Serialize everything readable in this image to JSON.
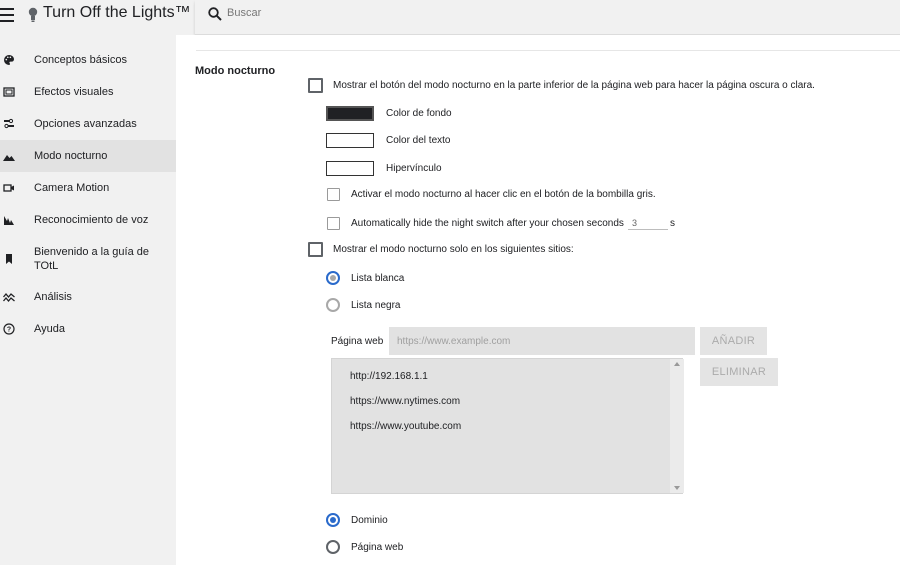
{
  "header": {
    "app_title": "Turn Off the Lights™",
    "search_placeholder": "Buscar"
  },
  "sidebar": {
    "items": [
      {
        "label": "Conceptos básicos",
        "icon": "palette-icon"
      },
      {
        "label": "Efectos visuales",
        "icon": "monitor-icon"
      },
      {
        "label": "Opciones avanzadas",
        "icon": "settings-sliders-icon"
      },
      {
        "label": "Modo nocturno",
        "icon": "landscape-icon",
        "active": true
      },
      {
        "label": "Camera Motion",
        "icon": "camera-icon"
      },
      {
        "label": "Reconocimiento de voz",
        "icon": "voice-wave-icon"
      },
      {
        "label": "Bienvenido a la guía de TOtL",
        "icon": "bookmark-icon"
      },
      {
        "label": "Análisis",
        "icon": "analytics-icon"
      },
      {
        "label": "Ayuda",
        "icon": "help-icon"
      }
    ]
  },
  "main": {
    "section_title": "Modo nocturno",
    "show_button_label": "Mostrar el botón del modo nocturno en la parte inferior de la página web para hacer la página oscura o clara.",
    "bg_color_label": "Color de fondo",
    "text_color_label": "Color del texto",
    "link_label": "Hipervínculo",
    "activate_label": "Activar el modo nocturno al hacer clic en el botón de la bombilla gris.",
    "autohide_label": "Automatically hide the night switch after your chosen seconds",
    "autohide_value": "3",
    "autohide_unit": "s",
    "only_sites_label": "Mostrar el modo nocturno solo en los siguientes sitios:",
    "whitelist_label": "Lista blanca",
    "blacklist_label": "Lista negra",
    "web_label": "Página web",
    "web_placeholder": "https://www.example.com",
    "add_button": "AÑADIR",
    "delete_button": "ELIMINAR",
    "sites": [
      "http://192.168.1.1",
      "https://www.nytimes.com",
      "https://www.youtube.com"
    ],
    "domain_label": "Dominio",
    "webpage_label": "Página web"
  },
  "colors": {
    "accent": "#2a6acb",
    "background_swatch": "#202124",
    "sidebar_bg": "#f1f1f1"
  }
}
